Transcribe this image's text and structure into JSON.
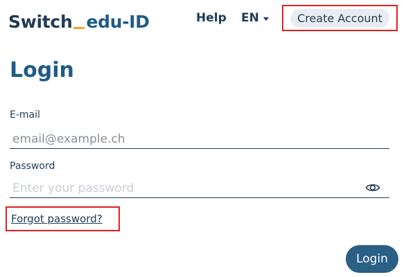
{
  "header": {
    "logo_part1": "Switch",
    "logo_part2": "edu-ID",
    "help_label": "Help",
    "language_label": "EN",
    "create_account_label": "Create Account"
  },
  "main": {
    "title": "Login",
    "email": {
      "label": "E-mail",
      "placeholder": "email@example.ch",
      "value": ""
    },
    "password": {
      "label": "Password",
      "placeholder": "Enter your password",
      "value": ""
    },
    "forgot_password_label": "Forgot password?",
    "login_button_label": "Login"
  },
  "icons": {
    "language_dropdown": "caret-down-icon",
    "password_visibility": "eye-icon"
  },
  "colors": {
    "brand_dark": "#1f3b57",
    "brand_blue": "#1f5c86",
    "accent_orange": "#f5a623",
    "button_bg": "#2a5f86",
    "highlight_red": "#e02020"
  }
}
